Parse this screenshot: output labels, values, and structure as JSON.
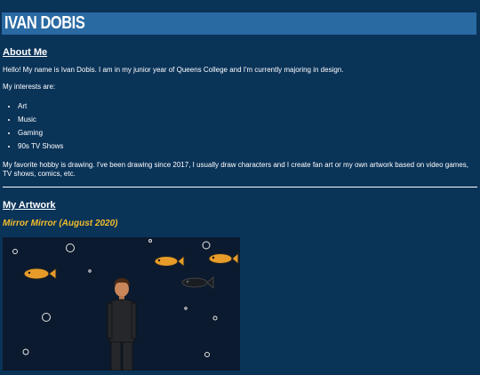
{
  "header": {
    "title": "IVAN DOBIS"
  },
  "about": {
    "heading": "About Me",
    "intro": "Hello! My name is Ivan Dobis. I am in my junior year of Queens College and I'm currently majoring in design.",
    "interests_label": "My interests are:",
    "interests": [
      "Art",
      "Music",
      "Gaming",
      "90s TV Shows"
    ],
    "hobby": "My favorite hobby is drawing. I've been drawing since 2017, I usually draw characters and I create fan art or my own artwork based on video games, TV shows, comics, etc."
  },
  "artwork": {
    "heading": "My Artwork",
    "piece_title": "Mirror Mirror (August 2020)"
  },
  "colors": {
    "background": "#0a3358",
    "header": "#2a6aa3",
    "accent": "#f2bd2b"
  }
}
